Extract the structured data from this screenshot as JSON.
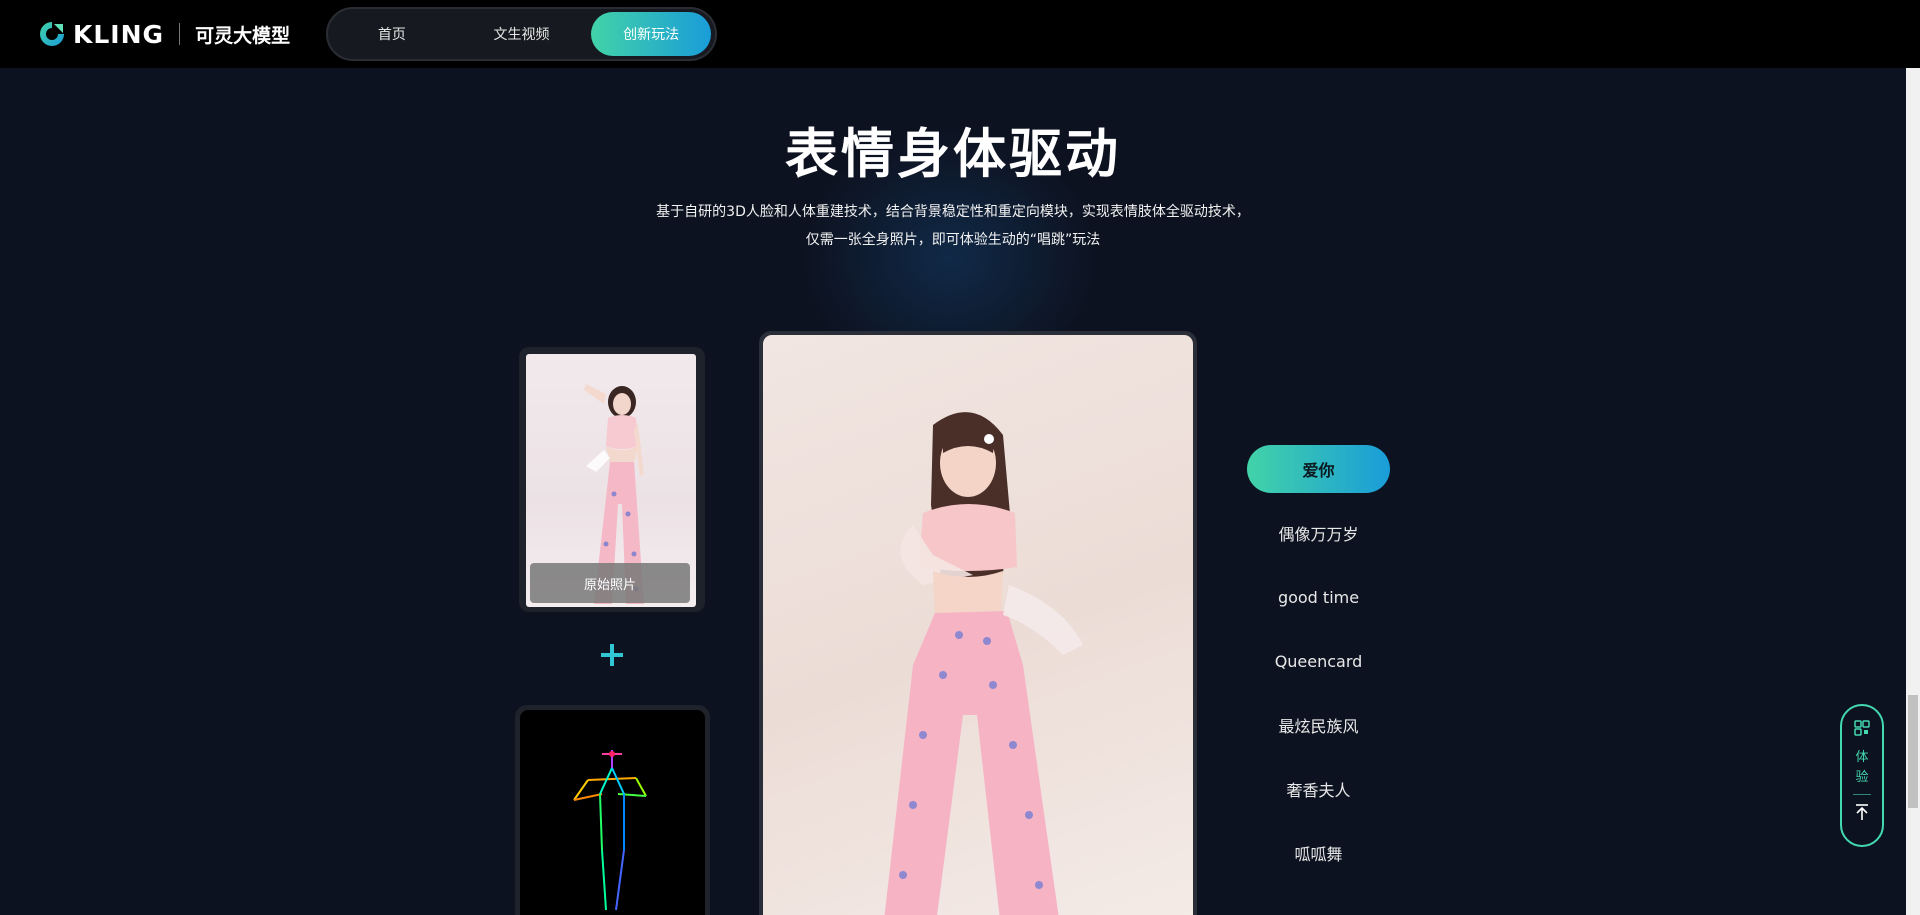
{
  "header": {
    "logo_word": "KLING",
    "logo_cn": "可灵大模型",
    "nav": [
      {
        "label": "首页",
        "active": false
      },
      {
        "label": "文生视频",
        "active": false
      },
      {
        "label": "创新玩法",
        "active": true
      }
    ]
  },
  "section": {
    "title": "表情身体驱动",
    "desc_line1": "基于自研的3D人脸和人体重建技术，结合背景稳定性和重定向模块，实现表情肢体全驱动技术，",
    "desc_line2": "仅需一张全身照片，即可体验生动的“唱跳”玩法"
  },
  "inputs": {
    "original_label": "原始照片"
  },
  "songs": [
    {
      "label": "爱你",
      "active": true
    },
    {
      "label": "偶像万万岁",
      "active": false
    },
    {
      "label": "good time",
      "active": false
    },
    {
      "label": "Queencard",
      "active": false
    },
    {
      "label": "最炫民族风",
      "active": false
    },
    {
      "label": "奢香夫人",
      "active": false
    },
    {
      "label": "呱呱舞",
      "active": false
    }
  ],
  "floating": {
    "experience_label": "体验"
  },
  "colors": {
    "accent_start": "#42d3a8",
    "accent_end": "#1a9cd8",
    "background": "#0d1220"
  }
}
